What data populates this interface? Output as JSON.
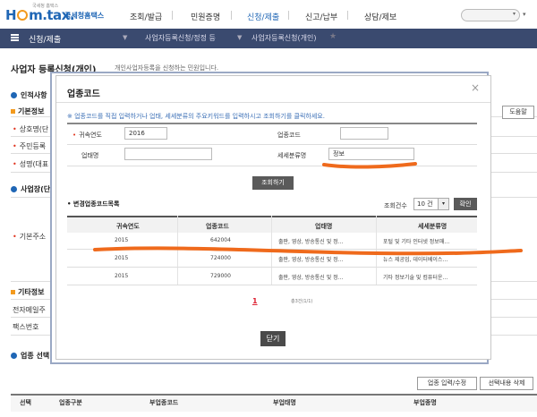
{
  "header": {
    "logo_top": "국세청 홈택스",
    "logo_brand_pre": "H",
    "logo_brand_post": "m.tax.",
    "logo_kr": "국세청홈택스",
    "menu": [
      "조회/발급",
      "민원증명",
      "신청/제출",
      "신고/납부",
      "상담/제보"
    ],
    "active_menu": "신청/제출",
    "search_dropdown": "▾",
    "search_toggle": "▾"
  },
  "nav": {
    "title": "신청/제출",
    "crumbs": [
      "사업자등록신청/정정 등",
      "사업자등록신청(개인)"
    ]
  },
  "page": {
    "title": "사업자 등록신청(개인)",
    "description": "개인사업자등록을 신청하는 민원입니다.",
    "sections": {
      "personal": "인적사항",
      "basic": "기본정보",
      "business": "사업장(단",
      "other": "기타정보",
      "industry": "업종 선택"
    },
    "labels": {
      "trade_name": "상호명(단",
      "resident_no": "주민등록",
      "name": "성명(대표",
      "address": "기본주소",
      "email": "전자메일주",
      "fax": "팩스번호"
    },
    "buttons": {
      "help": "도움말",
      "industry_edit": "업종 입력/수정",
      "select_delete": "선택내용 삭제"
    },
    "grid_columns": [
      "선택",
      "업종구분",
      "부업종코드",
      "부업태명",
      "부업종명"
    ]
  },
  "modal": {
    "title": "업종코드",
    "close_icon": "×",
    "notice": "※ 업종코드를 직접 입력하거나 업태, 세세분류의 주요키워드를 입력하시고 조회하기를 클릭하세요.",
    "fields": {
      "year_label": "귀속연도",
      "year_value": "2016",
      "code_label": "업종코드",
      "code_value": "",
      "business_type_label": "업태명",
      "business_type_value": "",
      "subclass_label": "세세분류명",
      "subclass_value": "정보"
    },
    "search_button": "조회하기",
    "list_title": "변경업종코드목록",
    "count_label": "조회건수",
    "count_value": "10 건",
    "count_arrow": "▾",
    "confirm_button": "확인",
    "table": {
      "headers": [
        "귀속연도",
        "업종코드",
        "업태명",
        "세세분류명"
      ],
      "rows": [
        [
          "2015",
          "642004",
          "출판, 영상, 방송통신 및 정…",
          "포털 및 기타 인터넷 정보매…"
        ],
        [
          "2015",
          "724000",
          "출판, 영상, 방송통신 및 정…",
          "뉴스 제공업, 데이터베이스…"
        ],
        [
          "2015",
          "729000",
          "출판, 영상, 방송통신 및 정…",
          "기타 정보기술 및 컴퓨터운…"
        ]
      ]
    },
    "pager_current": "1",
    "total_text": "총3건(1/1)",
    "close_button": "닫기"
  }
}
